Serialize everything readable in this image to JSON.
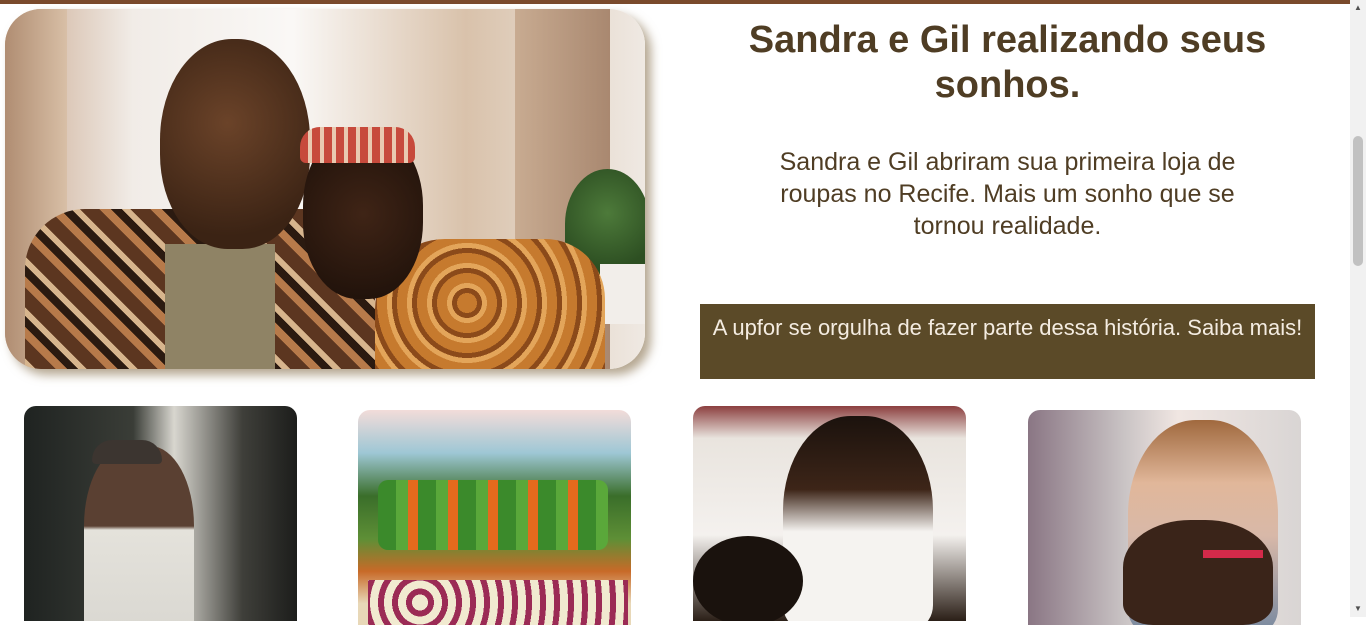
{
  "hero": {
    "title": "Sandra e Gil realizando seus sonhos.",
    "description": "Sandra e Gil abriram sua primeira loja de roupas no Recife. Mais um sonho que se tornou realidade.",
    "cta": "A upfor se orgulha de fazer parte dessa história. Saiba mais!"
  },
  "colors": {
    "top_bar": "#7a4a2c",
    "title_text": "#4f3d24",
    "cta_background": "#5b4a28",
    "cta_text": "#f4ece1"
  },
  "scrollbar": {
    "up_icon": "triangle-up",
    "down_icon": "triangle-down"
  }
}
